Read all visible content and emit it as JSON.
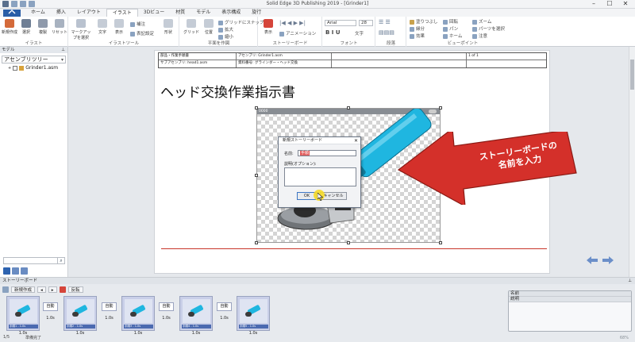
{
  "window": {
    "title": "Solid Edge 3D Publishing 2019 - [Grinder1]",
    "controls": [
      "–",
      "☐",
      "✕"
    ]
  },
  "tabs": {
    "file_label": "",
    "items": [
      "ホーム",
      "挿入",
      "レイアウト",
      "イラスト",
      "3Dビュー",
      "材質",
      "モデル",
      "表示構成",
      "旋行"
    ],
    "active_index": 3
  },
  "ribbon": {
    "illust_group": {
      "label": "イラスト",
      "buttons": [
        "新規作成",
        "選択",
        "複製",
        "リセット"
      ]
    },
    "tool_group": {
      "label": "イラストツール",
      "buttons": [
        "マークアップを選択",
        "文字",
        "表示",
        "形状"
      ],
      "extra": [
        "補注",
        "表記設定"
      ]
    },
    "plane_group": {
      "label": "平面を作図",
      "buttons": [
        "グリッド",
        "位置"
      ],
      "extra": [
        "グリッドにスナップ",
        "拡大",
        "縮小"
      ]
    },
    "story_group": {
      "label": "ストーリーボード",
      "buttons": [
        "表示"
      ],
      "extra": [
        "アニメーション"
      ]
    },
    "font_group": {
      "label": "フォント",
      "font_name": "Arial",
      "font_size": "28",
      "text_label": "文字"
    },
    "para_group": {
      "label": "段落"
    },
    "view_group": {
      "label": "ビューポイント",
      "items": [
        "塗りつぶし",
        "縁分",
        "効果",
        "回転",
        "パン",
        "ホーム",
        "ズーム",
        "パーツを選択",
        "注意"
      ]
    }
  },
  "left_panel": {
    "title": "モデル",
    "tree_title": "アセンブリツリー",
    "tree_item": "Grinder1.asm",
    "search_placeholder": "",
    "search_glyph": "⌕"
  },
  "document": {
    "header_rows": [
      [
        "部品・作業手順書",
        "アセンブリ: Grinder1.asm",
        "",
        "1 of 1"
      ],
      [
        "サブアセンブリ: head1.asm",
        "資料番号: グラインダー・ヘッド交換",
        "",
        ""
      ]
    ],
    "title": "ヘッド交換作業指示書",
    "canvas_strip_label": "0000",
    "callout_text": "ストーリーボードの\n名前を入力",
    "nav_prev": "previous page",
    "nav_next": "next page",
    "accent_red": "#d4302a",
    "accent_blue": "#1fb6e0"
  },
  "dialog": {
    "title": "新規ストーリーボード",
    "close": "✕",
    "name_label": "名前:",
    "name_value": "手順",
    "desc_label": "説明(オプション):",
    "ok_label": "OK",
    "cancel_label": "キャンセル"
  },
  "storyboard": {
    "panel_title": "ストーリーボード",
    "new_label": "新規作成",
    "reverse_label": "反転",
    "frames": [
      {
        "label": "手順1 - 1.0s",
        "duration": "1.0s"
      },
      {
        "label": "手順2 - 1.0s",
        "duration": "1.0s"
      },
      {
        "label": "手順3 - 1.0s",
        "duration": "1.0s"
      },
      {
        "label": "手順4 - 1.0s",
        "duration": "1.0s"
      },
      {
        "label": "手順5 - 1.0s",
        "duration": "1.0s"
      }
    ],
    "transitions": [
      {
        "label": "自動",
        "duration": "1.0s"
      },
      {
        "label": "自動",
        "duration": "1.0s"
      },
      {
        "label": "自動",
        "duration": "1.0s"
      },
      {
        "label": "自動",
        "duration": "1.0s"
      }
    ],
    "properties": {
      "name_label": "名前",
      "desc_label": "説明"
    },
    "footer_count": "1/5",
    "footer_status": "準備完了",
    "zoom": "68%"
  }
}
